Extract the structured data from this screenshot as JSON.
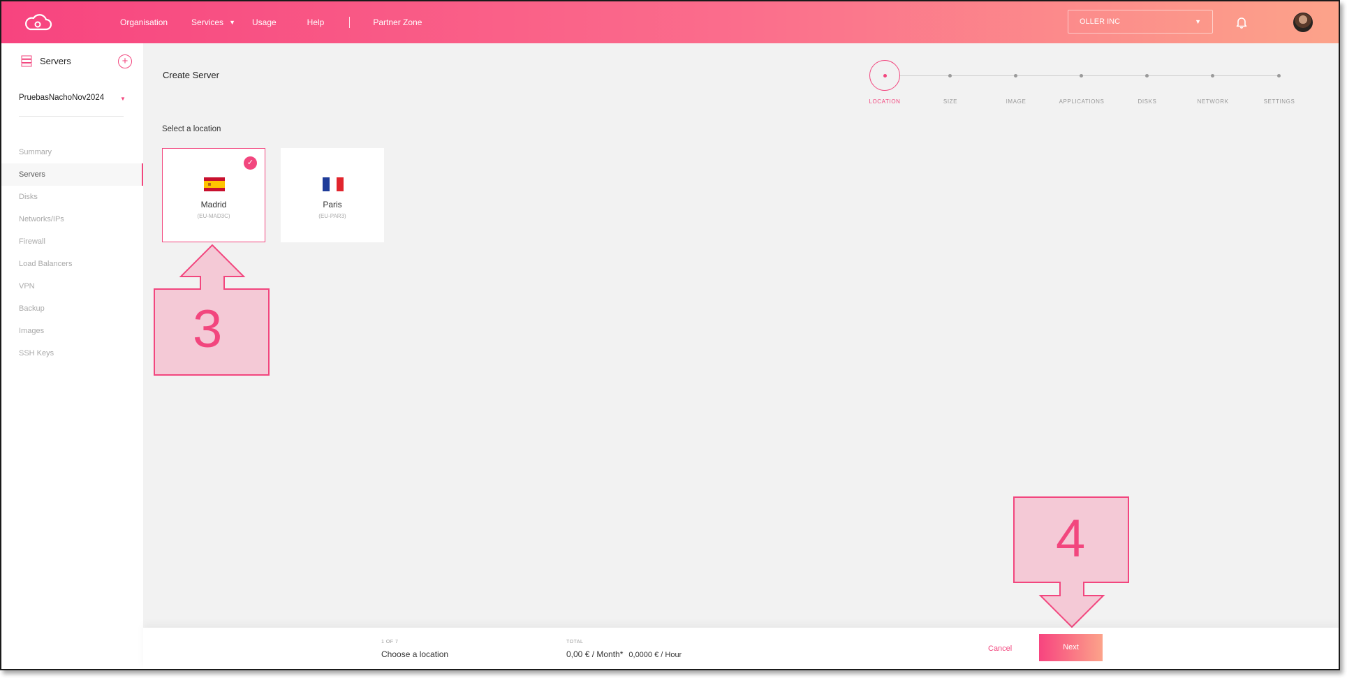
{
  "colors": {
    "accent": "#f2467e",
    "header_gradient_start": "#f7447f",
    "header_gradient_end": "#fca38a",
    "annotation_fill": "#f4c9d6"
  },
  "header": {
    "logo_icon": "cloud-logo-icon",
    "nav": {
      "organisation": "Organisation",
      "services": "Services",
      "usage": "Usage",
      "help": "Help",
      "partner_zone": "Partner Zone"
    },
    "org_selector": "OLLER INC",
    "bell_icon": "bell-icon"
  },
  "sidebar": {
    "title": "Servers",
    "add_icon": "+",
    "project": "PruebasNachoNov2024",
    "items": [
      {
        "label": "Summary"
      },
      {
        "label": "Servers"
      },
      {
        "label": "Disks"
      },
      {
        "label": "Networks/IPs"
      },
      {
        "label": "Firewall"
      },
      {
        "label": "Load Balancers"
      },
      {
        "label": "VPN"
      },
      {
        "label": "Backup"
      },
      {
        "label": "Images"
      },
      {
        "label": "SSH Keys"
      }
    ],
    "active_item": "Servers"
  },
  "main": {
    "title": "Create Server",
    "stepper": {
      "current": "LOCATION",
      "steps": [
        "LOCATION",
        "SIZE",
        "IMAGE",
        "APPLICATIONS",
        "DISKS",
        "NETWORK",
        "SETTINGS"
      ]
    },
    "section_label": "Select a location",
    "locations": [
      {
        "name": "Madrid",
        "code": "(EU-MAD3C)",
        "selected": true,
        "flag": "spain-flag"
      },
      {
        "name": "Paris",
        "code": "(EU-PAR3)",
        "selected": false,
        "flag": "france-flag"
      }
    ]
  },
  "annotations": {
    "step3": "3",
    "step4": "4"
  },
  "footer": {
    "step_counter": "1 OF 7",
    "step_text": "Choose a location",
    "total_label": "TOTAL",
    "total_month": "0,00 € / Month*",
    "total_hour": "0,0000 € / Hour",
    "cancel": "Cancel",
    "next": "Next"
  }
}
